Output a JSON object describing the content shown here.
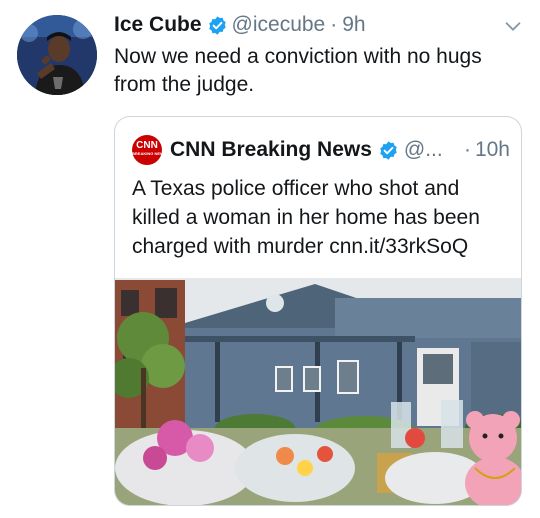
{
  "tweet": {
    "author_name": "Ice Cube",
    "author_handle": "@icecube",
    "separator": "·",
    "time": "9h",
    "text": "Now we need a conviction with no hugs from the judge."
  },
  "quoted_tweet": {
    "author_name": "CNN Breaking News",
    "author_handle": "@...",
    "separator": "·",
    "time": "10h",
    "text": "A Texas police officer who shot and killed a woman in her home has been charged with murder cnn.it/33rkSoQ",
    "logo_text": "CNN",
    "logo_subtext": "BREAKING NEWS"
  },
  "icons": {
    "verified": "verified-badge-icon",
    "more": "chevron-down-icon"
  },
  "colors": {
    "verified_blue": "#1da1f2",
    "secondary_text": "#657786",
    "border": "#ccd6dd",
    "cnn_red": "#cc0000"
  }
}
